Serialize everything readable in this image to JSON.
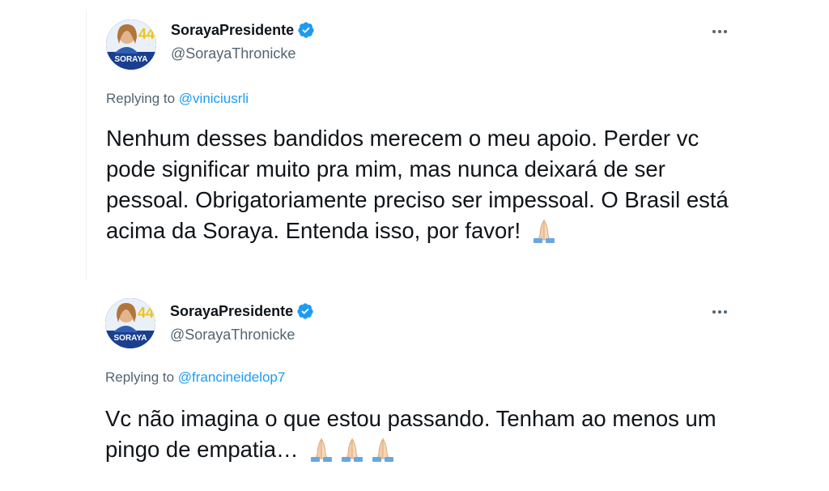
{
  "colors": {
    "text": "#0f1419",
    "secondary": "#536471",
    "link": "#1d9bf0",
    "verified": "#1d9bf0"
  },
  "tweets": [
    {
      "display_name": "SorayaPresidente",
      "handle": "@SorayaThronicke",
      "avatar_number": "44",
      "avatar_name": "SORAYA",
      "verified_icon": "verified-badge-icon",
      "more_icon": "more-options-icon",
      "replying_prefix": "Replying to ",
      "replying_to": "@viniciusrli",
      "text": "Nenhum desses bandidos merecem o meu apoio. Perder vc pode significar muito pra mim, mas nunca deixará de ser pessoal. Obrigatoriamente preciso ser impessoal. O Brasil está acima da Soraya. Entenda isso, por favor! ",
      "emoji": [
        "folded-hands-icon"
      ]
    },
    {
      "display_name": "SorayaPresidente",
      "handle": "@SorayaThronicke",
      "avatar_number": "44",
      "avatar_name": "SORAYA",
      "verified_icon": "verified-badge-icon",
      "more_icon": "more-options-icon",
      "replying_prefix": "Replying to ",
      "replying_to": "@francineidelop7",
      "text": "Vc não imagina o que estou passando. Tenham ao menos um pingo de empatia… ",
      "emoji": [
        "folded-hands-icon",
        "folded-hands-icon",
        "folded-hands-icon"
      ]
    }
  ]
}
